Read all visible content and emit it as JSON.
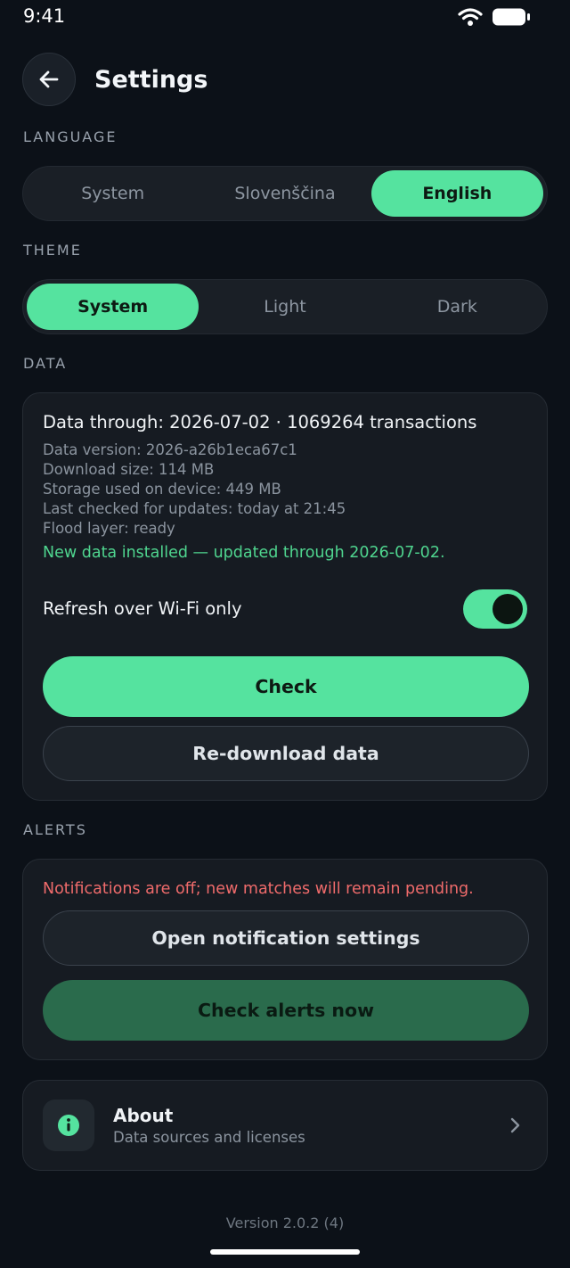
{
  "status_bar": {
    "time": "9:41"
  },
  "header": {
    "title": "Settings"
  },
  "language": {
    "label": "LANGUAGE",
    "options": [
      "System",
      "Slovenščina",
      "English"
    ],
    "selected": "English"
  },
  "theme": {
    "label": "THEME",
    "options": [
      "System",
      "Light",
      "Dark"
    ],
    "selected": "System"
  },
  "data": {
    "label": "DATA",
    "headline": "Data through: 2026-07-02 · 1069264 transactions",
    "version": "Data version: 2026-a26b1eca67c1",
    "download_size": "Download size: 114 MB",
    "storage": "Storage used on device: 449 MB",
    "last_checked": "Last checked for updates: today at 21:45",
    "flood_layer": "Flood layer: ready",
    "success_message": "New data installed — updated through 2026-07-02.",
    "wifi_only_label": "Refresh over Wi-Fi only",
    "wifi_only_enabled": true,
    "check_button": "Check",
    "redownload_button": "Re-download data"
  },
  "alerts": {
    "label": "ALERTS",
    "warning": "Notifications are off; new matches will remain pending.",
    "open_settings_button": "Open notification settings",
    "check_now_button": "Check alerts now"
  },
  "about": {
    "title": "About",
    "subtitle": "Data sources and licenses"
  },
  "footer": {
    "version": "Version 2.0.2 (4)"
  },
  "colors": {
    "background": "#0c1118",
    "accent": "#55e39f",
    "success": "#4fd58f",
    "warning": "#ef6b6b",
    "card": "#161b22"
  }
}
